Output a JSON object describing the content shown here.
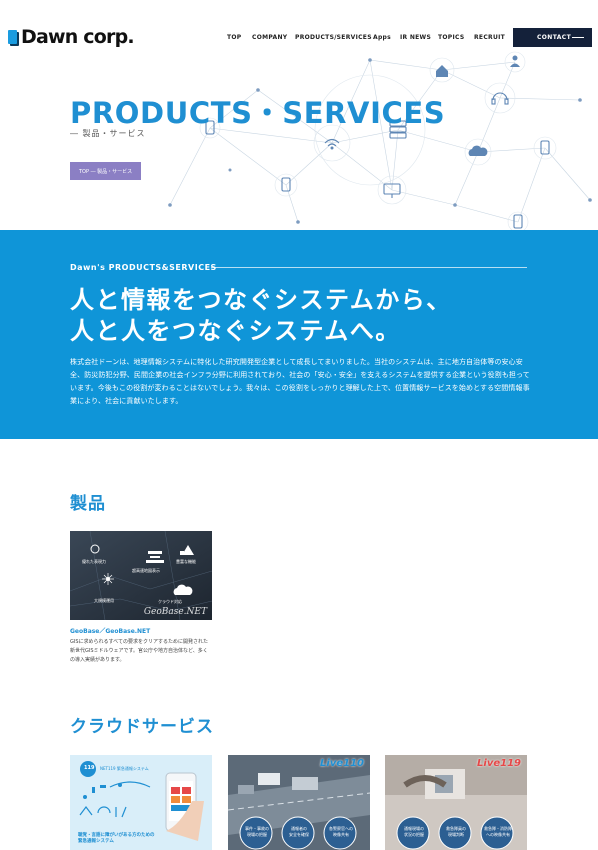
{
  "header": {
    "logo_text": "Dawn corp.",
    "nav": [
      {
        "label": "TOP"
      },
      {
        "label": "COMPANY"
      },
      {
        "label": "PRODUCTS/SERVICES"
      },
      {
        "label": "Apps"
      },
      {
        "label": "IR NEWS"
      },
      {
        "label": "TOPICS"
      },
      {
        "label": "RECRUIT"
      }
    ],
    "contact_label": "CONTACT"
  },
  "hero": {
    "title": "PRODUCTS・SERVICES",
    "subtitle": "― 製品・サービス",
    "breadcrumb": "TOP ― 製品・サービス"
  },
  "intro": {
    "label": "Dawn's PRODUCTS&SERVICES",
    "headline_1": "人と情報をつなぐシステムから、",
    "headline_2": "人と人をつなぐシステムへ。",
    "body": "株式会社ドーンは、地理情報システムに特化した研究開発型企業として成長してまいりました。当社のシステムは、主に地方自治体等の安心安全、防災防犯分野、民間企業の社会インフラ分野に利用されており、社会の「安心・安全」を支えるシステムを提供する企業という役割も担っています。今後もこの役割が変わることはないでしょう。我々は、この役割をしっかりと理解した上で、位置情報サービスを始めとする空間情報事業により、社会に貢献いたします。"
  },
  "products": {
    "title": "製品",
    "items": [
      {
        "name": "GeoBase／GeoBase.NET",
        "description": "GISに求められるすべての要求をクリアするために開発された新世代GISミドルウェアです。官公庁や地方自治体など、多くの導入実績があります。",
        "image_labels": [
          "優れた表現力",
          "豊富な機能",
          "超高速地図表示",
          "大規模運用",
          "クラウド対応"
        ],
        "image_brand": "GeoBase.NET"
      }
    ]
  },
  "cloud": {
    "title": "クラウドサービス",
    "cards": [
      {
        "badge": "119",
        "caption": "NET119 緊急通報システム",
        "footer": "聴覚・言語に障がいがある方のための緊急通報システム"
      },
      {
        "brand": "Live110",
        "bubbles": [
          "事件・事故の\n現場の把握",
          "通報者の\n安全を確保",
          "各警察官への\n映像共有"
        ]
      },
      {
        "brand": "Live119",
        "bubbles": [
          "通報現場の\n状況の把握",
          "救急隊員の\n現場判断",
          "救急隊・消防隊\nへの映像共有"
        ]
      }
    ]
  },
  "colors": {
    "accent_blue": "#1f8fd2",
    "intro_bg": "#0f95d8",
    "breadcrumb_bg": "#8b7fc4",
    "contact_bg": "#14213a"
  }
}
